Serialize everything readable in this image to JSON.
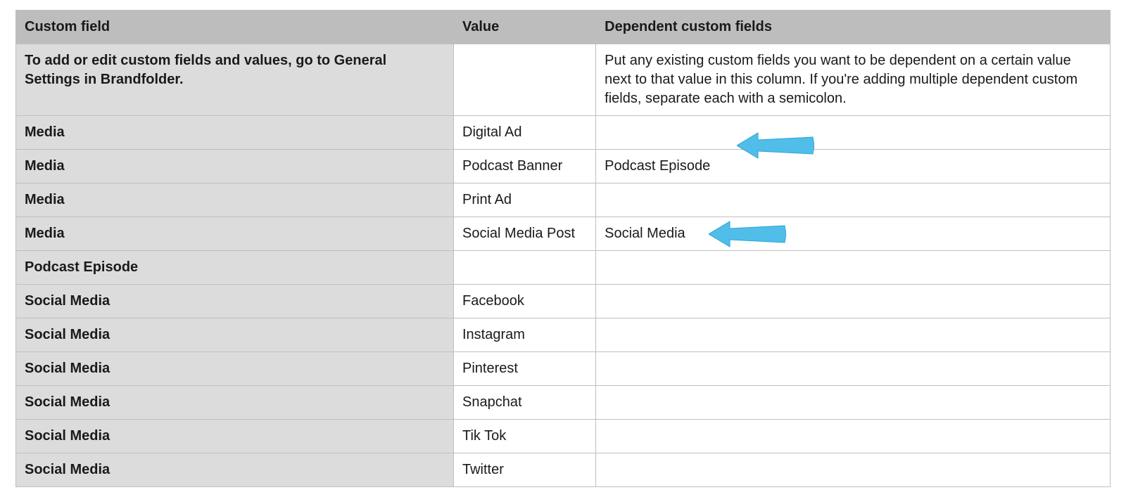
{
  "table": {
    "headers": {
      "custom_field": "Custom field",
      "value": "Value",
      "dependent": "Dependent custom fields"
    },
    "rows": [
      {
        "field": "To add or edit custom fields and values, go to General Settings in Brandfolder.",
        "value": "",
        "dependent": "Put any existing custom fields you want to be dependent on a certain value next to that value in this column. If you're adding multiple dependent custom fields, separate each with a semicolon."
      },
      {
        "field": "Media",
        "value": "Digital Ad",
        "dependent": ""
      },
      {
        "field": "Media",
        "value": "Podcast Banner",
        "dependent": "Podcast Episode",
        "arrow": "r1"
      },
      {
        "field": "Media",
        "value": "Print Ad",
        "dependent": ""
      },
      {
        "field": "Media",
        "value": "Social Media Post",
        "dependent": "Social Media",
        "arrow": "r2"
      },
      {
        "field": "Podcast Episode",
        "value": "",
        "dependent": ""
      },
      {
        "field": "Social Media",
        "value": "Facebook",
        "dependent": ""
      },
      {
        "field": "Social Media",
        "value": "Instagram",
        "dependent": ""
      },
      {
        "field": "Social Media",
        "value": "Pinterest",
        "dependent": ""
      },
      {
        "field": "Social Media",
        "value": "Snapchat",
        "dependent": ""
      },
      {
        "field": "Social Media",
        "value": "Tik Tok",
        "dependent": ""
      },
      {
        "field": "Social Media",
        "value": "Twitter",
        "dependent": ""
      }
    ]
  }
}
